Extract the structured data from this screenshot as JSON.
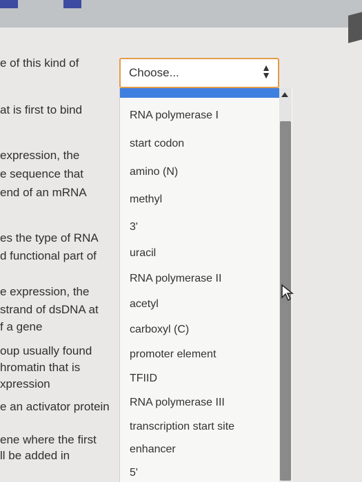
{
  "questions": [
    "e of this kind of",
    "at is first to bind",
    "expression, the",
    "e sequence that",
    "end of an mRNA",
    "es the type of RNA",
    "d functional part of",
    "e expression, the",
    "strand of dsDNA at",
    "f a gene",
    "oup usually found",
    "hromatin that is",
    "xpression",
    "e an activator protein",
    "ene where the first",
    "ll be added in"
  ],
  "select": {
    "value": "Choose...",
    "arrows": "◆"
  },
  "options": [
    "RNA polymerase I",
    "start codon",
    "amino (N)",
    "methyl",
    "3'",
    "uracil",
    "RNA polymerase II",
    "acetyl",
    "carboxyl (C)",
    "promoter element",
    "TFIID",
    "RNA polymerase III",
    "transcription start site",
    "enhancer",
    "5'"
  ],
  "colors": {
    "select_border": "#e39b47",
    "highlight": "#3f7fe0",
    "top_bar_mark": "#3d4ba1"
  }
}
